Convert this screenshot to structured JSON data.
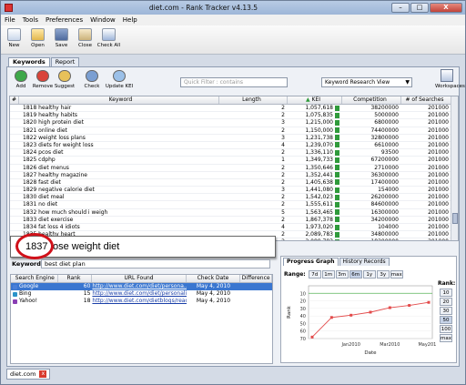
{
  "window": {
    "title": "diet.com - Rank Tracker v4.13.5",
    "min": "–",
    "max": "□",
    "close": "X"
  },
  "menu": [
    "File",
    "Tools",
    "Preferences",
    "Window",
    "Help"
  ],
  "toolbar": [
    "New",
    "Open",
    "Save",
    "Close",
    "Check All"
  ],
  "tabs": [
    "Keywords",
    "Report"
  ],
  "ktoolbar": [
    "Add",
    "Remove",
    "Suggest",
    "Check",
    "Update KEI"
  ],
  "quick_filter": "Quick Filter : contains",
  "view_select": "Keyword Research View",
  "workspaces": "Workspaces",
  "keyword_table": {
    "headers": [
      "#",
      "Keyword",
      "Length",
      "KEI",
      "Competition",
      "# of Searches"
    ],
    "rows": [
      [
        "1818 healthy hair",
        "2",
        "1,057,618",
        "38200000",
        "201000"
      ],
      [
        "1819 healthy habits",
        "2",
        "1,075,835",
        "5000000",
        "201000"
      ],
      [
        "1820 high protein diet",
        "3",
        "1,215,000",
        "6800000",
        "201000"
      ],
      [
        "1821 online diet",
        "2",
        "1,150,000",
        "74400000",
        "201000"
      ],
      [
        "1822 weight loss plans",
        "3",
        "1,231,738",
        "32800000",
        "201000"
      ],
      [
        "1823 diets for weight loss",
        "4",
        "1,239,070",
        "6610000",
        "201000"
      ],
      [
        "1824 pcos diet",
        "2",
        "1,336,110",
        "93500",
        "201000"
      ],
      [
        "1825 cdphp",
        "1",
        "1,349,733",
        "67200000",
        "201000"
      ],
      [
        "1826 diet menus",
        "2",
        "1,350,646",
        "2710000",
        "201000"
      ],
      [
        "1827 healthy magazine",
        "2",
        "1,352,441",
        "36300000",
        "201000"
      ],
      [
        "1828 fast diet",
        "2",
        "1,405,638",
        "17400000",
        "201000"
      ],
      [
        "1829 negative calorie diet",
        "3",
        "1,441,080",
        "154000",
        "201000"
      ],
      [
        "1830 diet meal",
        "2",
        "1,542,023",
        "26200000",
        "201000"
      ],
      [
        "1831 no diet",
        "2",
        "1,555,611",
        "84600000",
        "201000"
      ],
      [
        "1832 how much should i weigh",
        "5",
        "1,563,465",
        "16300000",
        "201000"
      ],
      [
        "1833 diet exercise",
        "2",
        "1,867,378",
        "34200000",
        "201000"
      ],
      [
        "1834 fat loss 4 idiots",
        "4",
        "1,973,020",
        "104000",
        "201000"
      ],
      [
        "1835 healthy heart",
        "2",
        "2,089,783",
        "34800000",
        "201000"
      ],
      [
        "1836 perfect body",
        "2",
        "2,089,783",
        "18200000",
        "201000"
      ],
      [
        "1837 lose weight diet",
        "3",
        "2,128,725",
        "24500000",
        "201000"
      ]
    ]
  },
  "callout": "1837 lose weight diet",
  "keyword_field": {
    "label": "Keyword:",
    "value": "best diet plan"
  },
  "rank_table": {
    "headers": [
      "Search Engine",
      "Rank",
      "URL Found",
      "Check Date",
      "Difference"
    ],
    "rows": [
      {
        "engine": "Google",
        "rank": "60",
        "url": "http://www.diet.com/diet/persona...",
        "date": "May 4, 2010",
        "diff": ""
      },
      {
        "engine": "Bing",
        "rank": "15",
        "url": "http://www.diet.com/diet/personalit...",
        "date": "May 4, 2010",
        "diff": ""
      },
      {
        "engine": "Yahoo!",
        "rank": "18",
        "url": "http://www.diet.com/dietblogs/read...",
        "date": "May 4, 2010",
        "diff": ""
      }
    ]
  },
  "graph": {
    "tabs": [
      "Progress Graph",
      "History Records"
    ],
    "range_label": "Range:",
    "range_buttons": [
      "7d",
      "1m",
      "3m",
      "6m",
      "1y",
      "3y",
      "max"
    ],
    "range_active": "6m",
    "rank_label": "Rank:",
    "rank_buttons": [
      "10",
      "20",
      "30",
      "50",
      "100",
      "max"
    ],
    "rank_active": "50",
    "xlabel": "Date",
    "ylabel": "Rank",
    "x_ticks": [
      "Jan2010",
      "Mar2010",
      "May2010"
    ],
    "y_ticks": [
      "10",
      "20",
      "30",
      "40",
      "50",
      "60",
      "70"
    ]
  },
  "chart_data": {
    "type": "line",
    "x": [
      "Nov2009",
      "Dec2009",
      "Jan2010",
      "Feb2010",
      "Mar2010",
      "Apr2010",
      "May2010"
    ],
    "values": [
      68,
      42,
      39,
      35,
      29,
      26,
      22
    ],
    "ylim": [
      0,
      70
    ],
    "xlabel": "Date",
    "ylabel": "Rank",
    "colors": {
      "line": "#e34b4b",
      "reference": "#5ab35a"
    }
  },
  "bottom_tab": "diet.com",
  "colors": {
    "kei_bar": "#2f9a3b",
    "selected_row": "#3a76d0",
    "callout_circle": "#d0111a"
  }
}
